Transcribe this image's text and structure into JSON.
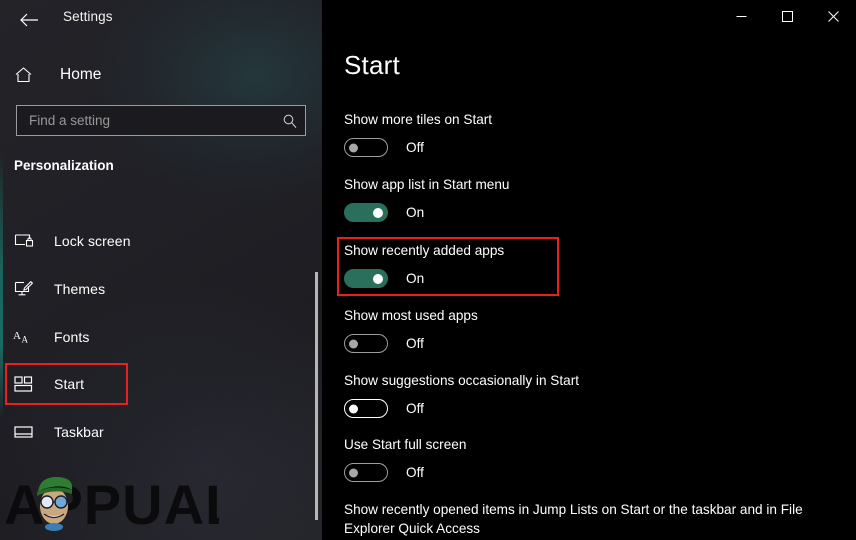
{
  "window": {
    "app_title": "Settings",
    "back_icon": "back-arrow-icon",
    "controls": {
      "minimize": "minimize-icon",
      "maximize": "maximize-icon",
      "close": "close-icon"
    }
  },
  "sidebar": {
    "home_label": "Home",
    "home_icon": "home-icon",
    "search": {
      "placeholder": "Find a setting",
      "value": "",
      "icon": "search-icon"
    },
    "section_heading": "Personalization",
    "items": [
      {
        "label": "Lock screen",
        "icon": "lock-screen-icon",
        "selected": false
      },
      {
        "label": "Themes",
        "icon": "themes-icon",
        "selected": false
      },
      {
        "label": "Fonts",
        "icon": "fonts-icon",
        "selected": false
      },
      {
        "label": "Start",
        "icon": "start-tiles-icon",
        "selected": true
      },
      {
        "label": "Taskbar",
        "icon": "taskbar-icon",
        "selected": false
      }
    ],
    "watermark_text": "APPUALS"
  },
  "main": {
    "title": "Start",
    "settings": [
      {
        "label": "Show more tiles on Start",
        "state": "Off",
        "on": false
      },
      {
        "label": "Show app list in Start menu",
        "state": "On",
        "on": true
      },
      {
        "label": "Show recently added apps",
        "state": "On",
        "on": true
      },
      {
        "label": "Show most used apps",
        "state": "Off",
        "on": false
      },
      {
        "label": "Show suggestions occasionally in Start",
        "state": "Off",
        "on": false
      },
      {
        "label": "Use Start full screen",
        "state": "Off",
        "on": false
      },
      {
        "label": "Show recently opened items in Jump Lists on Start or the taskbar and in File Explorer Quick Access",
        "state": "",
        "on": false
      }
    ]
  },
  "annotations": {
    "highlight_color": "#e8201f",
    "sidebar_highlight_target": "Start",
    "main_highlight_target": "Show recently added apps"
  },
  "colors": {
    "accent_on": "#2a6f5c",
    "background": "#000000",
    "sidebar_background": "#202026",
    "text": "#ffffff"
  }
}
